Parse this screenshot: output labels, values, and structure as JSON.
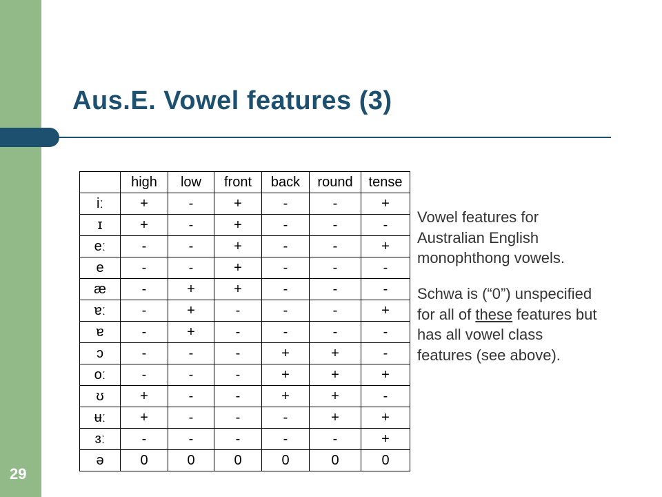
{
  "title": "Aus.E. Vowel features (3)",
  "page_number": "29",
  "table": {
    "headers": [
      "",
      "high",
      "low",
      "front",
      "back",
      "round",
      "tense"
    ],
    "rows": [
      {
        "vowel": "iː",
        "cells": [
          "+",
          "-",
          "+",
          "-",
          "-",
          "+"
        ]
      },
      {
        "vowel": "ɪ",
        "cells": [
          "+",
          "-",
          "+",
          "-",
          "-",
          "-"
        ]
      },
      {
        "vowel": "eː",
        "cells": [
          "-",
          "-",
          "+",
          "-",
          "-",
          "+"
        ]
      },
      {
        "vowel": "e",
        "cells": [
          "-",
          "-",
          "+",
          "-",
          "-",
          "-"
        ]
      },
      {
        "vowel": "æ",
        "cells": [
          "-",
          "+",
          "+",
          "-",
          "-",
          "-"
        ]
      },
      {
        "vowel": "ɐː",
        "cells": [
          "-",
          "+",
          "-",
          "-",
          "-",
          "+"
        ]
      },
      {
        "vowel": "ɐ",
        "cells": [
          "-",
          "+",
          "-",
          "-",
          "-",
          "-"
        ]
      },
      {
        "vowel": "ɔ",
        "cells": [
          "-",
          "-",
          "-",
          "+",
          "+",
          "-"
        ]
      },
      {
        "vowel": "oː",
        "cells": [
          "-",
          "-",
          "-",
          "+",
          "+",
          "+"
        ]
      },
      {
        "vowel": "ʊ",
        "cells": [
          "+",
          "-",
          "-",
          "+",
          "+",
          "-"
        ]
      },
      {
        "vowel": "ʉː",
        "cells": [
          "+",
          "-",
          "-",
          "-",
          "+",
          "+"
        ]
      },
      {
        "vowel": "ɜː",
        "cells": [
          "-",
          "-",
          "-",
          "-",
          "-",
          "+"
        ]
      },
      {
        "vowel": "ə",
        "cells": [
          "0",
          "0",
          "0",
          "0",
          "0",
          "0"
        ]
      }
    ]
  },
  "side": {
    "p1": "Vowel features for Australian English monophthong vowels.",
    "p2a": "Schwa is (“0”) unspecified for all of ",
    "p2_these": "these",
    "p2b": " features but has all vowel class features (see above)."
  }
}
